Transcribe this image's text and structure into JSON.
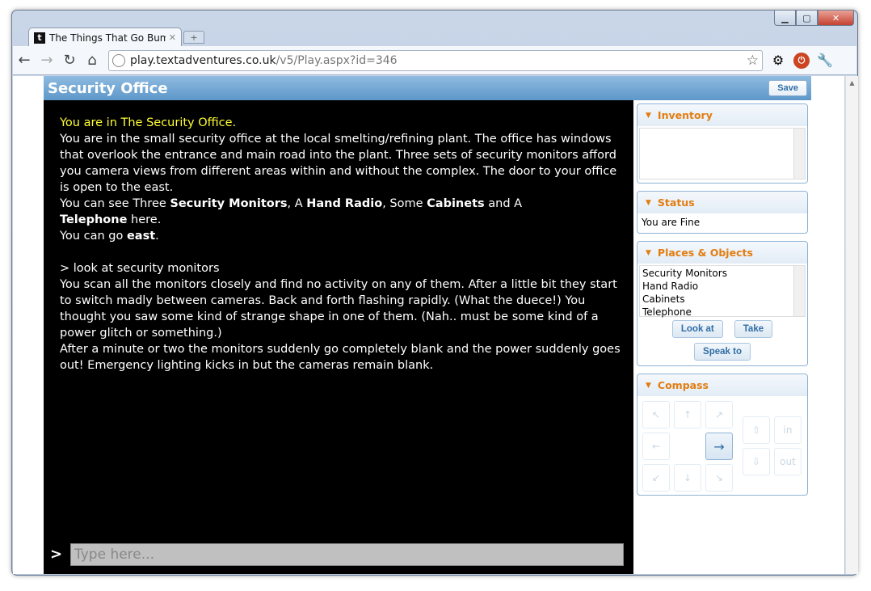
{
  "browser": {
    "tab_title": "The Things That Go Bump I",
    "tab_favicon": "t",
    "url_host": "play.textadventures.co.uk",
    "url_path": "/v5/Play.aspx?id=346"
  },
  "game": {
    "room_title": "Security Office",
    "save_label": "Save",
    "output": {
      "location_line": "You are in The Security Office.",
      "description": "You are in the small security office at the local smelting/refining plant. The office has windows that overlook the entrance and main road into the plant. Three sets of security monitors afford you camera views from different areas within and without the complex. The door to your office is open to the east.",
      "see_prefix": "You can see Three ",
      "see_item1": "Security Monitors",
      "see_sep1": ", A ",
      "see_item2": "Hand Radio",
      "see_sep2": ", Some ",
      "see_item3": "Cabinets",
      "see_sep3": " and A",
      "see_item4": "Telephone",
      "see_suffix": " here.",
      "go_prefix": "You can go ",
      "go_dir": "east",
      "go_suffix": ".",
      "command": "> look at security monitors",
      "response1": "You scan all the monitors closely and find no activity on any of them. After a little bit they start to switch madly between cameras. Back and forth flashing rapidly. (What the duece!) You thought you saw some kind of strange shape in one of them. (Nah.. must be some kind of a power glitch or something.)",
      "response2": "After a minute or two the monitors suddenly go completely blank and the power suddenly goes out! Emergency lighting kicks in but the cameras remain blank."
    },
    "prompt_symbol": ">",
    "input_placeholder": "Type here..."
  },
  "sidebar": {
    "inventory_title": "Inventory",
    "status_title": "Status",
    "status_text": "You are Fine",
    "places_title": "Places & Objects",
    "places": [
      "Security Monitors",
      "Hand Radio",
      "Cabinets",
      "Telephone"
    ],
    "look_at_label": "Look at",
    "take_label": "Take",
    "speak_to_label": "Speak to",
    "compass_title": "Compass",
    "compass": {
      "nw": "↖",
      "n": "↑",
      "ne": "↗",
      "w": "←",
      "e": "→",
      "sw": "↙",
      "s": "↓",
      "se": "↘",
      "up": "⇧",
      "down": "⇩",
      "in": "in",
      "out": "out"
    }
  }
}
